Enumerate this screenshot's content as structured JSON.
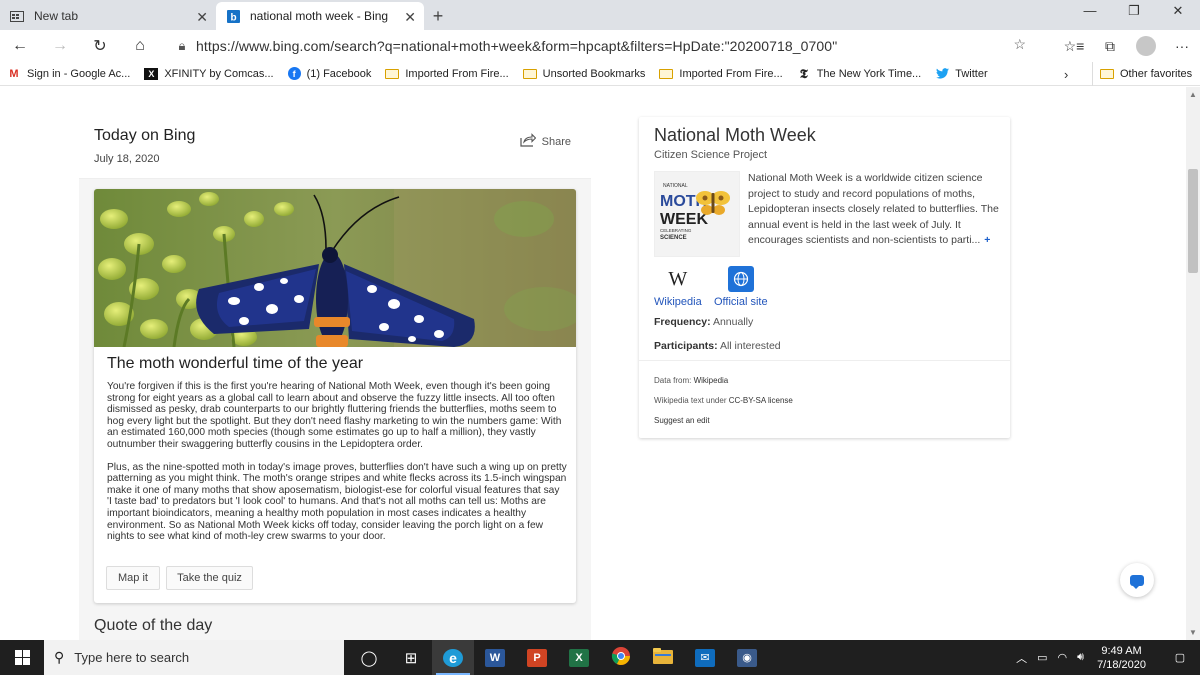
{
  "tabs": [
    {
      "title": "New tab",
      "icon": "newtab-icon",
      "active": false
    },
    {
      "title": "national moth week - Bing",
      "icon": "bing-icon",
      "active": true
    }
  ],
  "window_controls": {
    "minimize": "—",
    "restore": "❐",
    "close": "✕"
  },
  "address_bar": {
    "url": "https://www.bing.com/search?q=national+moth+week&form=hpcapt&filters=HpDate:\"20200718_0700\""
  },
  "favorites": [
    {
      "label": "Sign in - Google Ac...",
      "icon": "gmail-icon",
      "glyph": "M"
    },
    {
      "label": "XFINITY by Comcas...",
      "icon": "xfinity-icon",
      "glyph": "X"
    },
    {
      "label": "(1) Facebook",
      "icon": "facebook-icon",
      "glyph": "f"
    },
    {
      "label": "Imported From Fire...",
      "icon": "folder-icon"
    },
    {
      "label": "Unsorted Bookmarks",
      "icon": "folder-icon"
    },
    {
      "label": "Imported From Fire...",
      "icon": "folder-icon"
    },
    {
      "label": "The New York Time...",
      "icon": "nyt-icon",
      "glyph": "𝕿"
    },
    {
      "label": "Twitter",
      "icon": "twitter-icon",
      "glyph": "🐦"
    }
  ],
  "favorites_more": "›",
  "other_favorites": "Other favorites",
  "today": {
    "title": "Today on Bing",
    "date": "July 18, 2020",
    "share": "Share",
    "card_title": "The moth wonderful time of the year",
    "paragraphs": [
      "You're forgiven if this is the first you're hearing of National Moth Week, even though it's been going strong for eight years as a global call to learn about and observe the fuzzy little insects. All too often dismissed as pesky, drab counterparts to our brightly fluttering friends the butterflies, moths seem to hog every light but the spotlight. But they don't need flashy marketing to win the numbers game: With an estimated 160,000 moth species (though some estimates go up to half a million), they vastly outnumber their swaggering butterfly cousins in the Lepidoptera order.",
      "Plus, as the nine-spotted moth in today's image proves, butterflies don't have such a wing up on pretty patterning as you might think. The moth's orange stripes and white flecks across its 1.5-inch wingspan make it one of many moths that show aposematism, biologist-ese for colorful visual features that say 'I taste bad' to predators but 'I look cool' to humans. And that's not all moths can tell us: Moths are important bioindicators, meaning a healthy moth population in most cases indicates a healthy environment. So as National Moth Week kicks off today, consider leaving the porch light on a few nights to see what kind of moth-ley crew swarms to your door."
    ],
    "map_button": "Map it",
    "quiz_button": "Take the quiz",
    "quote_heading": "Quote of the day"
  },
  "knowledge": {
    "title": "National Moth Week",
    "subtitle": "Citizen Science Project",
    "logo": {
      "top_text": "NATIONAL",
      "line1": "MOTH",
      "line2": "WEEK",
      "bottom1": "CELEBRATING",
      "bottom2": "SCIENCE"
    },
    "description": "National Moth Week is a worldwide citizen science project to study and record populations of moths, Lepidopteran insects closely related to butterflies. The annual event is held in the last week of July. It encourages scientists and non-scientists to parti...",
    "more": "+",
    "wikipedia": "Wikipedia",
    "wikipedia_glyph": "W",
    "official_site": "Official site",
    "facts": [
      {
        "label": "Frequency:",
        "value": "Annually"
      },
      {
        "label": "Participants:",
        "value": "All interested"
      }
    ],
    "data_from_prefix": "Data from: ",
    "data_from_link": "Wikipedia",
    "license_prefix": "Wikipedia text under ",
    "license_link": "CC-BY-SA license",
    "suggest": "Suggest an edit"
  },
  "taskbar": {
    "search_placeholder": "Type here to search",
    "apps": [
      {
        "name": "task-view",
        "glyph": "◯",
        "color": "transparent"
      },
      {
        "name": "timeline",
        "glyph": "⊞",
        "color": "transparent"
      },
      {
        "name": "edge",
        "glyph": "e",
        "color": "#1f9bd7",
        "active": true
      },
      {
        "name": "word",
        "glyph": "W",
        "color": "#2b579a"
      },
      {
        "name": "powerpoint",
        "glyph": "P",
        "color": "#d04423"
      },
      {
        "name": "excel",
        "glyph": "X",
        "color": "#217346"
      },
      {
        "name": "chrome",
        "glyph": "●",
        "color": "#db4437"
      },
      {
        "name": "file-explorer",
        "glyph": "▬",
        "color": "#e8b43a"
      },
      {
        "name": "mail",
        "glyph": "✉",
        "color": "#0f6cbd"
      },
      {
        "name": "camera",
        "glyph": "◉",
        "color": "#3a5a8a"
      }
    ],
    "time": "9:49 AM",
    "date": "7/18/2020"
  }
}
